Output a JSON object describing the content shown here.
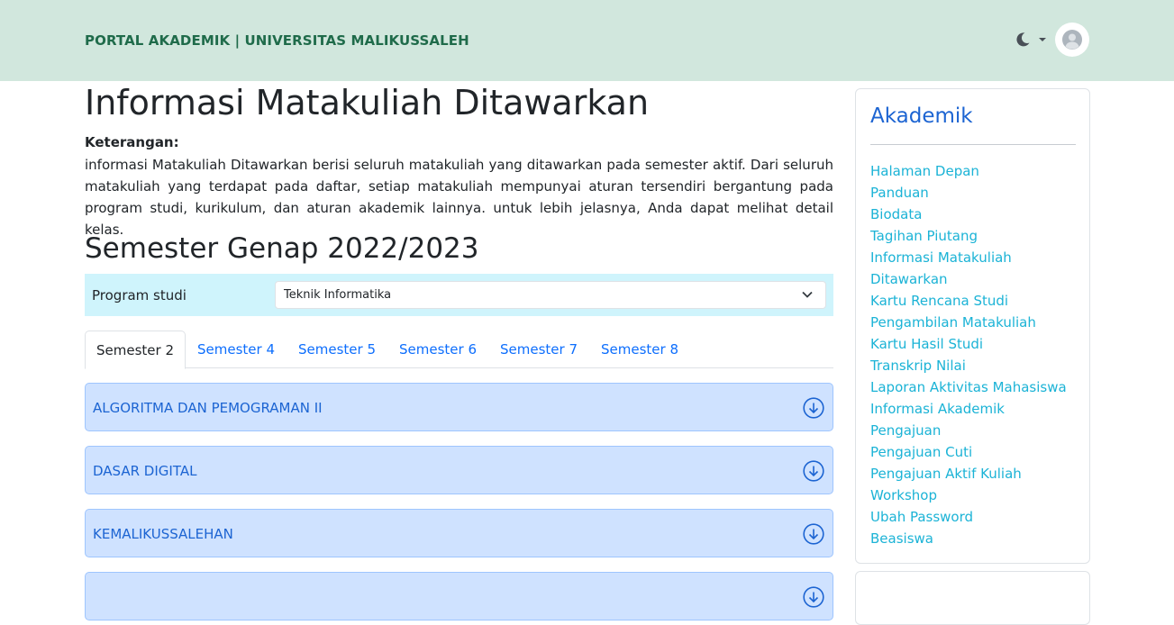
{
  "navbar": {
    "brand": "PORTAL AKADEMIK | UNIVERSITAS MALIKUSSALEH",
    "theme_icon": "moon-icon",
    "avatar_icon": "user-avatar-icon"
  },
  "main": {
    "title": "Informasi Matakuliah Ditawarkan",
    "note_label": "Keterangan:",
    "note_text": "informasi Matakuliah Ditawarkan berisi seluruh matakuliah yang ditawarkan pada semester aktif. Dari seluruh matakuliah yang terdapat pada daftar, setiap matakuliah mempunyai aturan tersendiri bergantung pada program studi, kurikulum, dan aturan akademik lainnya. untuk lebih jelasnya, Anda dapat melihat detail kelas.",
    "semester_title": "Semester Genap 2022/2023",
    "program_label": "Program studi",
    "program_value": "Teknik Informatika",
    "tabs": [
      "Semester 2",
      "Semester 4",
      "Semester 5",
      "Semester 6",
      "Semester 7",
      "Semester 8"
    ],
    "active_tab": "Semester 2",
    "courses": [
      "ALGORITMA DAN PEMOGRAMAN II",
      "DASAR DIGITAL",
      "KEMALIKUSSALEHAN",
      ""
    ]
  },
  "sidebar": {
    "title": "Akademik",
    "links": [
      "Halaman Depan",
      "Panduan",
      "Biodata",
      "Tagihan Piutang",
      "Informasi Matakuliah Ditawarkan",
      "Kartu Rencana Studi",
      "Pengambilan Matakuliah",
      "Kartu Hasil Studi",
      "Transkrip Nilai",
      "Laporan Aktivitas Mahasiswa",
      "Informasi Akademik",
      "Pengajuan",
      "Pengajuan Cuti",
      "Pengajuan Aktif Kuliah",
      "Workshop",
      "Ubah Password",
      "Beasiswa"
    ]
  },
  "colors": {
    "navbar_bg": "#d1e7dd",
    "brand": "#1f6b4a",
    "accordion_bg": "#cfe2ff",
    "accordion_text": "#1c64d2",
    "link": "#1bb3d6",
    "info_bar": "#cff4fc"
  }
}
